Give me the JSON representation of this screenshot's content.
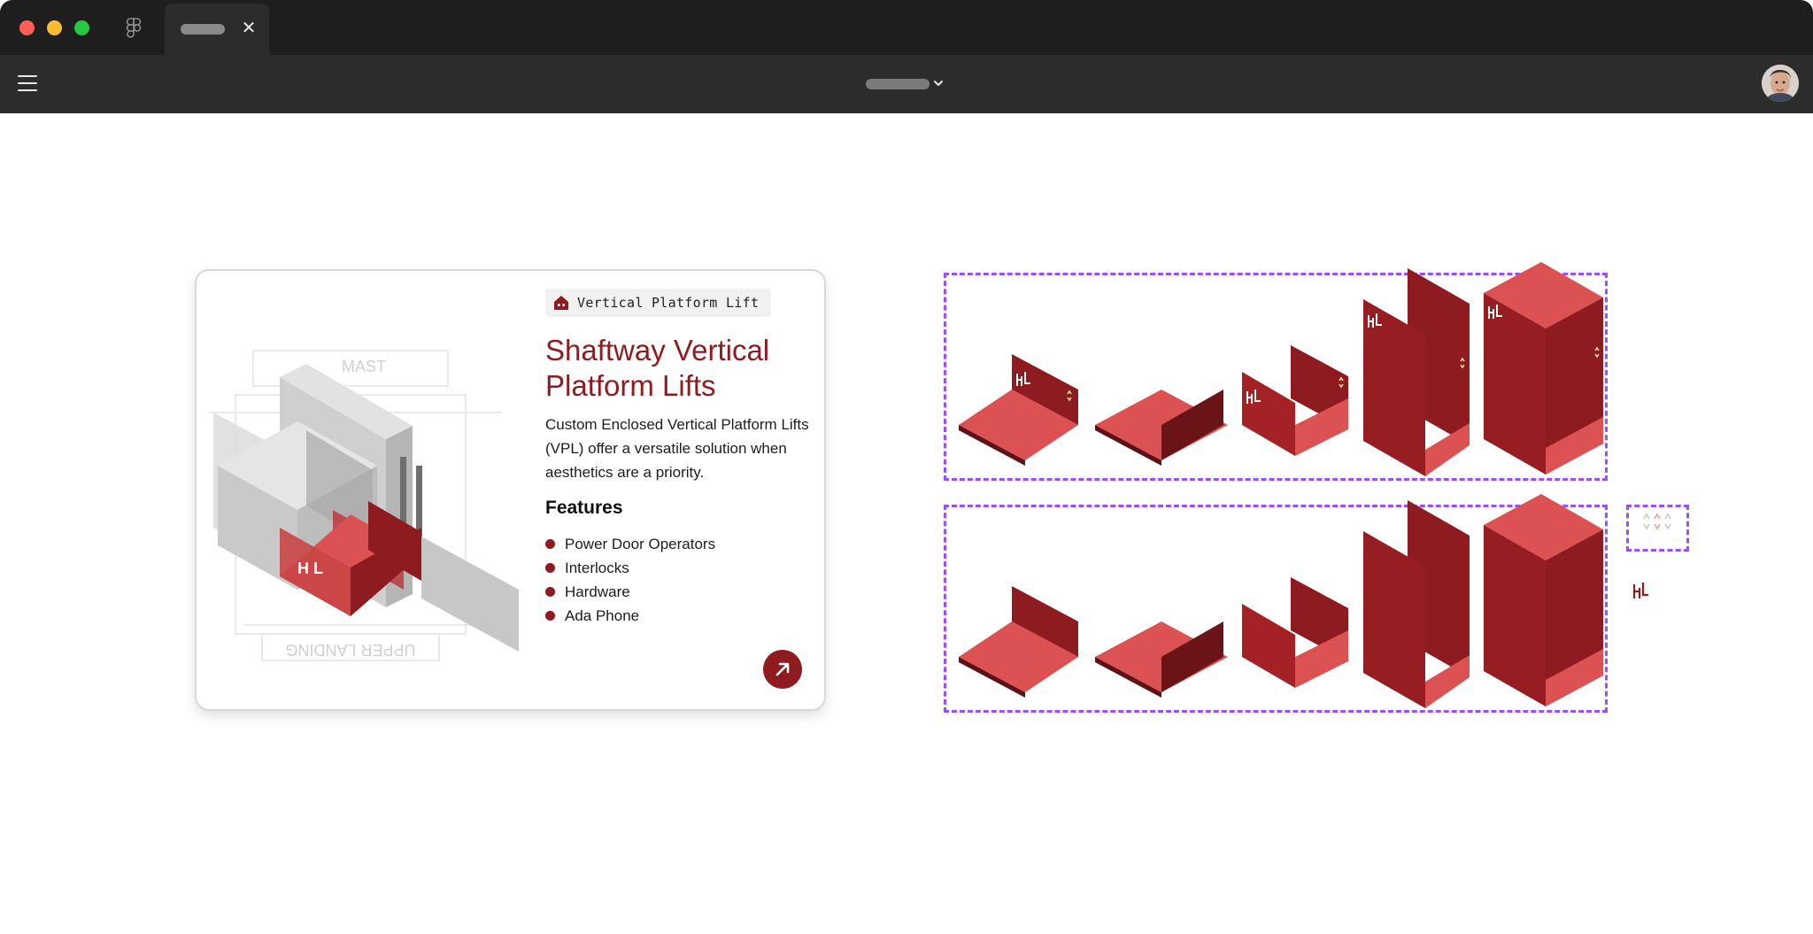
{
  "window": {
    "tab_title": "",
    "file_name": ""
  },
  "icons": {
    "app": "figma-icon",
    "menu": "hamburger-menu-icon",
    "close": "close-icon",
    "chevron": "chevron-down-icon",
    "avatar": "user-avatar",
    "badge": "home-icon",
    "arrow": "arrow-up-right-icon",
    "logo": "hl-logo-icon"
  },
  "colors": {
    "accent": "#8f1a1f",
    "lift_light": "#dc5252",
    "lift_dark": "#8d1b20",
    "frame_border": "#9b4dff",
    "titlebar": "#1e1e1e",
    "toolbar": "#2c2c2c"
  },
  "card": {
    "badge_label": "Vertical Platform Lift",
    "title": "Shaftway Vertical Platform Lifts",
    "description": "Custom Enclosed Vertical Platform Lifts (VPL) offer a versatile solution when aesthetics are a priority.",
    "features_heading": "Features",
    "features": [
      "Power Door Operators",
      "Interlocks",
      "Hardware",
      "Ada Phone"
    ],
    "illustration_labels": [
      "MAST",
      "UPPER LANDING"
    ]
  }
}
